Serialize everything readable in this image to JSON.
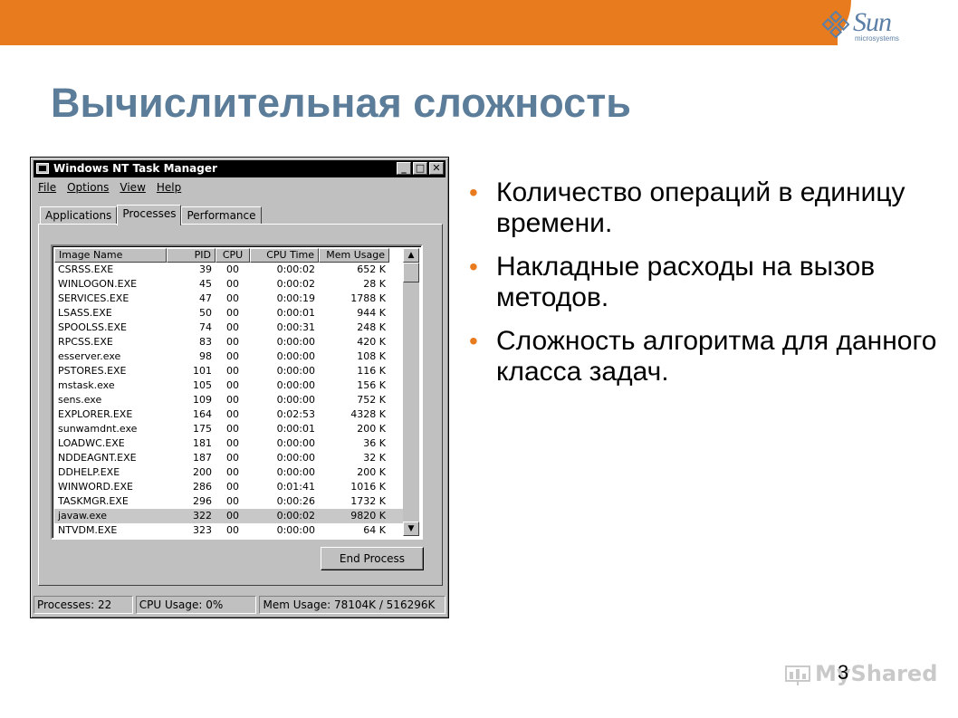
{
  "slide": {
    "title": "Вычислительная сложность",
    "page_number": "3",
    "bullets": [
      "Количество операций в единицу времени.",
      "Накладные расходы на вызов методов.",
      "Сложность алгоритма для данного класса задач."
    ],
    "accent_color": "#e87b1e",
    "title_color": "#5c7d99"
  },
  "logo": {
    "word": "Sun",
    "sub": "microsystems"
  },
  "watermark": {
    "text": "MyShared"
  },
  "window": {
    "title": "Windows NT Task Manager",
    "menu": [
      "File",
      "Options",
      "View",
      "Help"
    ],
    "tabs": [
      "Applications",
      "Processes",
      "Performance"
    ],
    "active_tab": "Processes",
    "columns": [
      "Image Name",
      "PID",
      "CPU",
      "CPU Time",
      "Mem Usage"
    ],
    "processes": [
      [
        "CSRSS.EXE",
        "39",
        "00",
        "0:00:02",
        "652 K"
      ],
      [
        "WINLOGON.EXE",
        "45",
        "00",
        "0:00:02",
        "28 K"
      ],
      [
        "SERVICES.EXE",
        "47",
        "00",
        "0:00:19",
        "1788 K"
      ],
      [
        "LSASS.EXE",
        "50",
        "00",
        "0:00:01",
        "944 K"
      ],
      [
        "SPOOLSS.EXE",
        "74",
        "00",
        "0:00:31",
        "248 K"
      ],
      [
        "RPCSS.EXE",
        "83",
        "00",
        "0:00:00",
        "420 K"
      ],
      [
        "esserver.exe",
        "98",
        "00",
        "0:00:00",
        "108 K"
      ],
      [
        "PSTORES.EXE",
        "101",
        "00",
        "0:00:00",
        "116 K"
      ],
      [
        "mstask.exe",
        "105",
        "00",
        "0:00:00",
        "156 K"
      ],
      [
        "sens.exe",
        "109",
        "00",
        "0:00:00",
        "752 K"
      ],
      [
        "EXPLORER.EXE",
        "164",
        "00",
        "0:02:53",
        "4328 K"
      ],
      [
        "sunwamdnt.exe",
        "175",
        "00",
        "0:00:01",
        "200 K"
      ],
      [
        "LOADWC.EXE",
        "181",
        "00",
        "0:00:00",
        "36 K"
      ],
      [
        "NDDEAGNT.EXE",
        "187",
        "00",
        "0:00:00",
        "32 K"
      ],
      [
        "DDHELP.EXE",
        "200",
        "00",
        "0:00:00",
        "200 K"
      ],
      [
        "WINWORD.EXE",
        "286",
        "00",
        "0:01:41",
        "1016 K"
      ],
      [
        "TASKMGR.EXE",
        "296",
        "00",
        "0:00:26",
        "1732 K"
      ],
      [
        "javaw.exe",
        "322",
        "00",
        "0:00:02",
        "9820 K"
      ],
      [
        "NTVDM.EXE",
        "323",
        "00",
        "0:00:00",
        "64 K"
      ]
    ],
    "selected_process": "javaw.exe",
    "end_process_label": "End Process",
    "status": {
      "processes": "Processes: 22",
      "cpu": "CPU Usage: 0%",
      "mem": "Mem Usage: 78104K / 516296K"
    }
  }
}
